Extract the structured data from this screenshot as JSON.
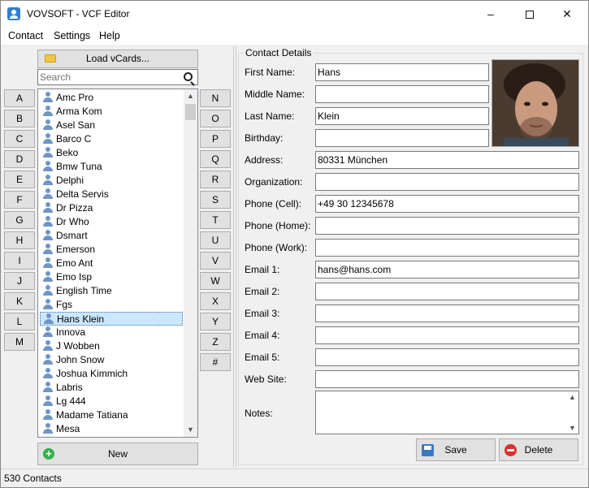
{
  "window": {
    "title": "VOVSOFT - VCF Editor",
    "minimize": "–",
    "close": "✕"
  },
  "menu": [
    "Contact",
    "Settings",
    "Help"
  ],
  "left": {
    "load_label": "Load vCards...",
    "search_placeholder": "Search",
    "letters_left": [
      "A",
      "B",
      "C",
      "D",
      "E",
      "F",
      "G",
      "H",
      "I",
      "J",
      "K",
      "L",
      "M"
    ],
    "letters_right": [
      "N",
      "O",
      "P",
      "Q",
      "R",
      "S",
      "T",
      "U",
      "V",
      "W",
      "X",
      "Y",
      "Z",
      "#"
    ],
    "contacts": [
      "Amc Pro",
      "Arma Kom",
      "Asel San",
      "Barco C",
      "Beko",
      "Bmw Tuna",
      "Delphi",
      "Delta Servis",
      "Dr Pizza",
      "Dr Who",
      "Dsmart",
      "Emerson",
      "Emo Ant",
      "Emo Isp",
      "English Time",
      "Fgs",
      "Hans Klein",
      "Innova",
      "J Wobben",
      "John Snow",
      "Joshua Kimmich",
      "Labris",
      "Lg 444",
      "Madame Tatiana",
      "Mesa"
    ],
    "selected_index": 16,
    "new_label": "New"
  },
  "details": {
    "title": "Contact Details",
    "fields": [
      {
        "label": "First Name:",
        "value": "Hans"
      },
      {
        "label": "Middle Name:",
        "value": ""
      },
      {
        "label": "Last Name:",
        "value": "Klein"
      },
      {
        "label": "Birthday:",
        "value": ""
      },
      {
        "label": "Address:",
        "value": "80331 München"
      },
      {
        "label": "Organization:",
        "value": ""
      },
      {
        "label": "Phone (Cell):",
        "value": "+49 30 12345678"
      },
      {
        "label": "Phone (Home):",
        "value": ""
      },
      {
        "label": "Phone (Work):",
        "value": ""
      },
      {
        "label": "Email 1:",
        "value": "hans@hans.com"
      },
      {
        "label": "Email 2:",
        "value": ""
      },
      {
        "label": "Email 3:",
        "value": ""
      },
      {
        "label": "Email 4:",
        "value": ""
      },
      {
        "label": "Email 5:",
        "value": ""
      },
      {
        "label": "Web Site:",
        "value": ""
      }
    ],
    "notes_label": "Notes:",
    "notes_value": "",
    "save_label": "Save",
    "delete_label": "Delete"
  },
  "status": {
    "text": "530 Contacts"
  }
}
